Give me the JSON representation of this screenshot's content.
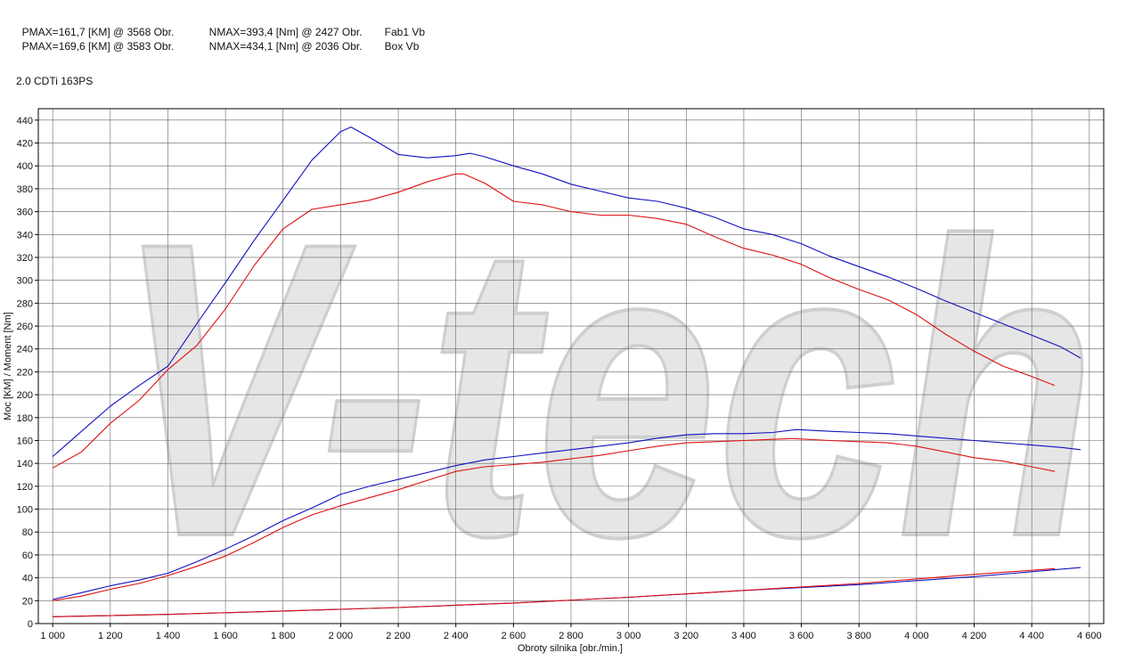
{
  "header": {
    "run1": {
      "pmax": "PMAX=161,7 [KM] @ 3568 Obr.",
      "nmax": "NMAX=393,4 [Nm] @ 2427 Obr.",
      "name": "Fab1 Vb"
    },
    "run2": {
      "pmax": "PMAX=169,6 [KM] @ 3583 Obr.",
      "nmax": "NMAX=434,1 [Nm] @ 2036 Obr.",
      "name": "Box Vb"
    },
    "model": "2.0 CDTi 163PS"
  },
  "watermark": "V-tech",
  "chart_data": {
    "type": "line",
    "xlabel": "Obroty silnika [obr./min.]",
    "ylabel": "Moc [KM] / Moment [Nm]",
    "xlim": [
      950,
      4650
    ],
    "ylim": [
      0,
      450
    ],
    "x_ticks": [
      1000,
      1200,
      1400,
      1600,
      1800,
      2000,
      2200,
      2400,
      2600,
      2800,
      3000,
      3200,
      3400,
      3600,
      3800,
      4000,
      4200,
      4400,
      4600
    ],
    "x_tick_labels": [
      "1 000",
      "1 200",
      "1 400",
      "1 600",
      "1 800",
      "2 000",
      "2 200",
      "2 400",
      "2 600",
      "2 800",
      "3 000",
      "3 200",
      "3 400",
      "3 600",
      "3 800",
      "4 000",
      "4 200",
      "4 400",
      "4 600"
    ],
    "y_ticks": [
      0,
      20,
      40,
      60,
      80,
      100,
      120,
      140,
      160,
      180,
      200,
      220,
      240,
      260,
      280,
      300,
      320,
      340,
      360,
      380,
      400,
      420,
      440
    ],
    "grid": true,
    "colors": {
      "run1": "#e01010",
      "run2": "#1010c0",
      "frame": "#000000",
      "grid": "#666666"
    },
    "series": [
      {
        "run": "run2",
        "kind": "torque",
        "x": [
          1000,
          1100,
          1200,
          1300,
          1400,
          1500,
          1600,
          1700,
          1800,
          1900,
          2000,
          2036,
          2100,
          2200,
          2300,
          2400,
          2450,
          2500,
          2600,
          2700,
          2800,
          2900,
          3000,
          3100,
          3200,
          3300,
          3400,
          3500,
          3600,
          3700,
          3800,
          3900,
          4000,
          4100,
          4200,
          4300,
          4400,
          4500,
          4570
        ],
        "y": [
          146,
          168,
          190,
          208,
          225,
          262,
          298,
          335,
          370,
          405,
          430,
          434,
          425,
          410,
          407,
          409,
          411,
          408,
          400,
          393,
          384,
          378,
          372,
          369,
          363,
          355,
          345,
          340,
          332,
          321,
          312,
          303,
          293,
          282,
          272,
          262,
          252,
          242,
          232
        ]
      },
      {
        "run": "run1",
        "kind": "torque",
        "x": [
          1000,
          1100,
          1200,
          1300,
          1400,
          1500,
          1600,
          1700,
          1800,
          1900,
          2000,
          2100,
          2200,
          2300,
          2400,
          2427,
          2500,
          2600,
          2700,
          2800,
          2900,
          3000,
          3100,
          3200,
          3300,
          3400,
          3500,
          3600,
          3700,
          3800,
          3900,
          4000,
          4100,
          4200,
          4300,
          4400,
          4480
        ],
        "y": [
          136,
          150,
          175,
          195,
          222,
          243,
          275,
          313,
          345,
          362,
          366,
          370,
          377,
          386,
          393,
          393,
          385,
          369,
          366,
          360,
          357,
          357,
          354,
          349,
          338,
          328,
          322,
          314,
          302,
          292,
          283,
          270,
          253,
          238,
          225,
          216,
          208
        ]
      },
      {
        "run": "run2",
        "kind": "power",
        "x": [
          1000,
          1100,
          1200,
          1300,
          1400,
          1500,
          1600,
          1700,
          1800,
          1900,
          2000,
          2100,
          2200,
          2300,
          2400,
          2500,
          2600,
          2700,
          2800,
          2900,
          3000,
          3100,
          3200,
          3300,
          3400,
          3500,
          3583,
          3700,
          3800,
          3900,
          4000,
          4100,
          4200,
          4300,
          4400,
          4500,
          4570
        ],
        "y": [
          21,
          27,
          33,
          38,
          44,
          54,
          65,
          77,
          90,
          101,
          113,
          120,
          126,
          132,
          138,
          143,
          146,
          149,
          152,
          155,
          158,
          162,
          165,
          166,
          166,
          167,
          169.6,
          168,
          167,
          166,
          164,
          162,
          160,
          158,
          156,
          154,
          152
        ]
      },
      {
        "run": "run1",
        "kind": "power",
        "x": [
          1000,
          1100,
          1200,
          1300,
          1400,
          1500,
          1600,
          1700,
          1800,
          1900,
          2000,
          2100,
          2200,
          2300,
          2400,
          2500,
          2600,
          2700,
          2800,
          2900,
          3000,
          3100,
          3200,
          3300,
          3400,
          3500,
          3568,
          3700,
          3800,
          3900,
          4000,
          4100,
          4200,
          4300,
          4400,
          4480
        ],
        "y": [
          20,
          24,
          30,
          35,
          42,
          50,
          59,
          71,
          84,
          95,
          103,
          110,
          117,
          125,
          133,
          137,
          139,
          141,
          144,
          147,
          151,
          155,
          158,
          159,
          160,
          161,
          161.7,
          160,
          159,
          158,
          155,
          150,
          145,
          142,
          137,
          133
        ]
      },
      {
        "run": "run2",
        "kind": "loss",
        "x": [
          1000,
          1400,
          1800,
          2200,
          2600,
          3000,
          3400,
          3800,
          4200,
          4570
        ],
        "y": [
          6,
          8,
          11,
          14,
          18,
          23,
          29,
          34,
          41,
          49
        ]
      },
      {
        "run": "run1",
        "kind": "loss",
        "x": [
          1000,
          1400,
          1800,
          2200,
          2600,
          3000,
          3400,
          3800,
          4200,
          4480
        ],
        "y": [
          6,
          8,
          11,
          14,
          18,
          23,
          29,
          35,
          43,
          48
        ]
      }
    ]
  }
}
